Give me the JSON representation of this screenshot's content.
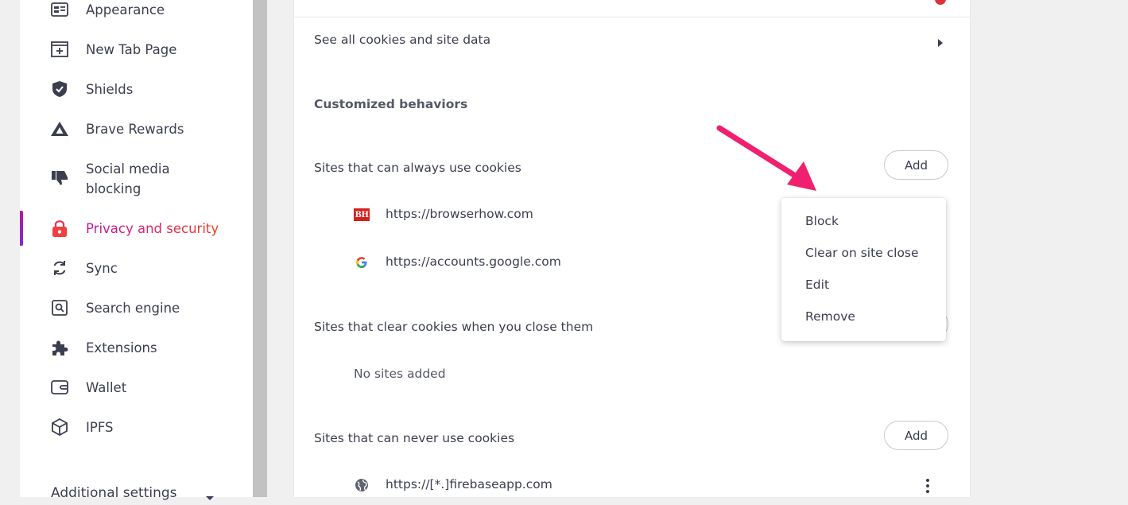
{
  "sidebar": {
    "items": [
      {
        "label": "Appearance",
        "icon": "appearance-icon"
      },
      {
        "label": "New Tab Page",
        "icon": "new-tab-icon"
      },
      {
        "label": "Shields",
        "icon": "shield-icon"
      },
      {
        "label": "Brave Rewards",
        "icon": "rewards-triangle-icon"
      },
      {
        "label": "Social media\nblocking",
        "icon": "thumbs-down-icon"
      },
      {
        "label": "Privacy and security",
        "icon": "lock-icon"
      },
      {
        "label": "Sync",
        "icon": "sync-icon"
      },
      {
        "label": "Search engine",
        "icon": "search-engine-icon"
      },
      {
        "label": "Extensions",
        "icon": "puzzle-icon"
      },
      {
        "label": "Wallet",
        "icon": "wallet-icon"
      },
      {
        "label": "IPFS",
        "icon": "cube-icon"
      }
    ],
    "additional_settings": "Additional settings",
    "active_index": 5
  },
  "main": {
    "see_all": "See all cookies and site data",
    "customized_title": "Customized behaviors",
    "allow_section": {
      "label": "Sites that can always use cookies",
      "add_label": "Add",
      "sites": [
        "https://browserhow.com",
        "https://accounts.google.com"
      ],
      "site_icons": [
        "bh-logo-icon",
        "google-icon"
      ]
    },
    "clear_section": {
      "label": "Sites that clear cookies when you close them",
      "empty": "No sites added"
    },
    "block_section": {
      "label": "Sites that can never use cookies",
      "add_label": "Add",
      "sites": [
        "https://[*.]firebaseapp.com"
      ],
      "site_icons": [
        "globe-icon"
      ]
    }
  },
  "context_menu": {
    "items": [
      "Block",
      "Clear on site close",
      "Edit",
      "Remove"
    ]
  },
  "bh_logo_text": "BH",
  "colors": {
    "accent": "#c02ad0",
    "arrow": "#f0206e"
  }
}
